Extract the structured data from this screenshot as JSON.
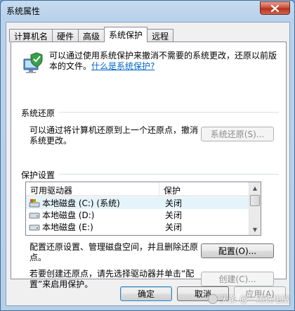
{
  "window": {
    "title": "系统属性"
  },
  "tabs": [
    {
      "label": "计算机名"
    },
    {
      "label": "硬件"
    },
    {
      "label": "高级"
    },
    {
      "label": "系统保护",
      "active": true
    },
    {
      "label": "远程"
    }
  ],
  "intro": {
    "text": "可以通过使用系统保护来撤消不需要的系统更改，还原以前版本的文件。",
    "link": "什么是系统保护?"
  },
  "restore": {
    "group_label": "系统还原",
    "description": "可以通过将计算机还原到上一个还原点，撤消系统更改。",
    "button": "系统还原(S)..."
  },
  "protection": {
    "group_label": "保护设置",
    "columns": [
      "可用驱动器",
      "保护"
    ],
    "drives": [
      {
        "name": "本地磁盘 (C:) (系统)",
        "protection": "关闭",
        "icon": "system-drive-icon"
      },
      {
        "name": "本地磁盘 (D:)",
        "protection": "关闭",
        "icon": "drive-icon"
      },
      {
        "name": "本地磁盘 (E:)",
        "protection": "关闭",
        "icon": "drive-icon"
      }
    ],
    "configure_description": "配置还原设置、管理磁盘空间，并且删除还原点。",
    "configure_button": "配置(O)...",
    "create_description": "若要创建还原点，请先选择驱动器并单击“配置”来启用保护。",
    "create_button": "创建(C)..."
  },
  "footer": {
    "ok": "确定",
    "cancel": "取消",
    "apply": "应用(A)"
  },
  "watermark": {
    "text": "头条 @一涛说电脑"
  }
}
